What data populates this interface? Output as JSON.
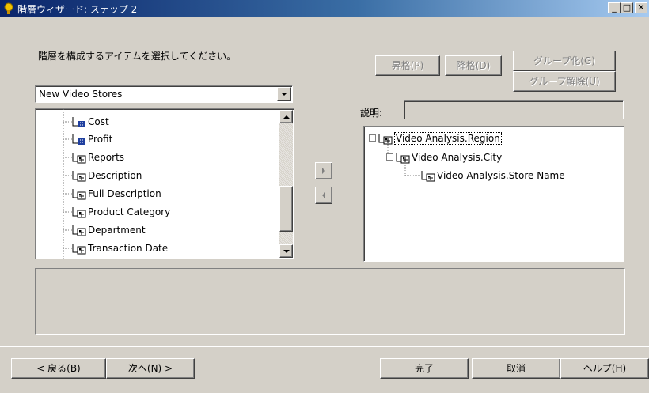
{
  "window": {
    "title": "階層ウィザード: ステップ 2",
    "minimize": "_",
    "maximize": "□",
    "close": "✕"
  },
  "instruction": "階層を構成するアイテムを選択してください。",
  "buttons": {
    "promote": "昇格(P)",
    "demote": "降格(D)",
    "group": "グループ化(G)",
    "ungroup": "グループ解除(U)",
    "back": "< 戻る(B)",
    "next": "次へ(N) >",
    "finish": "完了",
    "cancel": "取消",
    "help": "ヘルプ(H)"
  },
  "source_combo": {
    "selected": "New Video Stores"
  },
  "description_label": "説明:",
  "description_value": "",
  "source_items": [
    {
      "label": "Cost",
      "icon": "measure-icon"
    },
    {
      "label": "Profit",
      "icon": "measure-icon"
    },
    {
      "label": "Reports",
      "icon": "dimension-icon"
    },
    {
      "label": "Description",
      "icon": "dimension-icon"
    },
    {
      "label": "Full Description",
      "icon": "dimension-icon"
    },
    {
      "label": "Product Category",
      "icon": "dimension-icon"
    },
    {
      "label": "Department",
      "icon": "dimension-icon"
    },
    {
      "label": "Transaction Date",
      "icon": "dimension-icon"
    }
  ],
  "hierarchy_items": [
    {
      "label": "Video Analysis.Region",
      "level": 0
    },
    {
      "label": "Video Analysis.City",
      "level": 1
    },
    {
      "label": "Video Analysis.Store Name",
      "level": 2
    }
  ]
}
